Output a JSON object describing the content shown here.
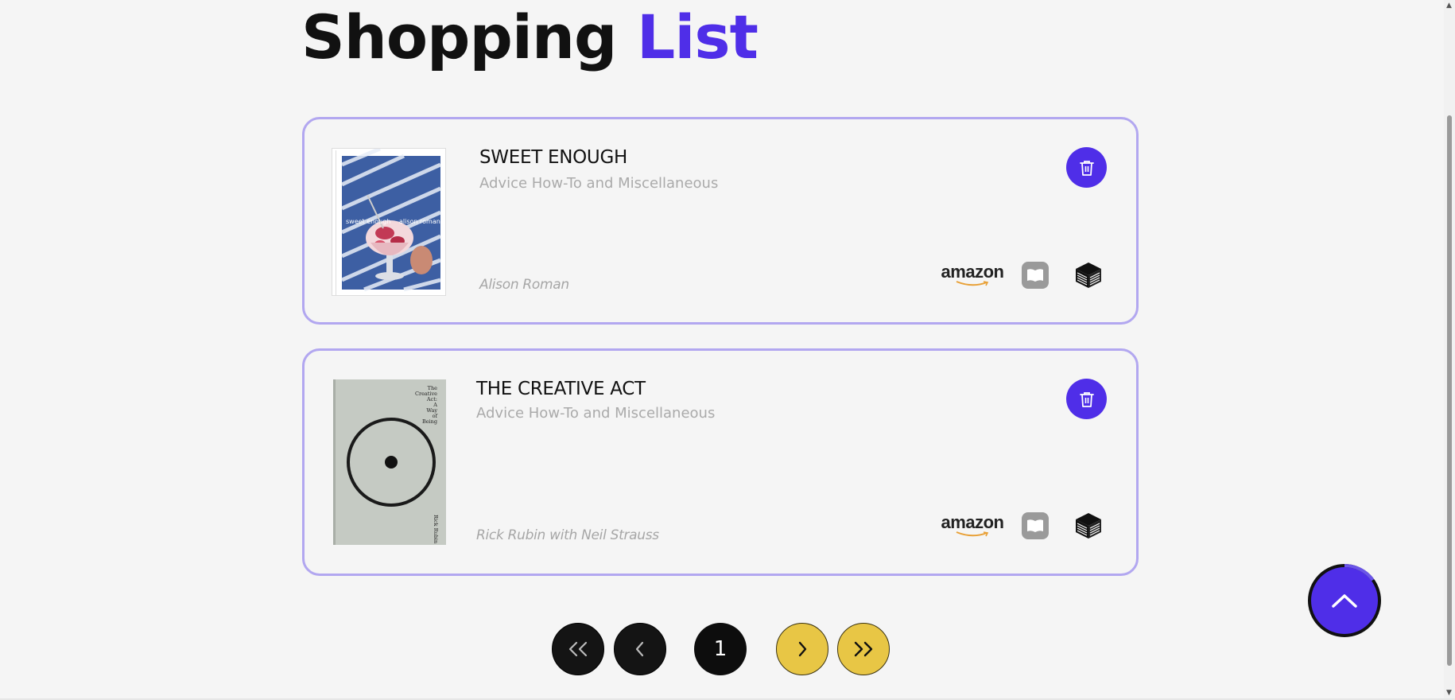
{
  "header": {
    "title_part1": "Shopping",
    "title_part2": "List"
  },
  "colors": {
    "accent": "#4f2ee8",
    "card_border": "#b2a7f0",
    "pager_yellow": "#e8c645",
    "pager_dark": "#141414"
  },
  "books": [
    {
      "title": "SWEET ENOUGH",
      "category": "Advice How-To and Miscellaneous",
      "author": "Alison Roman",
      "cover_text_left": "sweet enough",
      "cover_text_right": "alison roman",
      "stores": [
        "amazon",
        "apple-books",
        "bookshop"
      ]
    },
    {
      "title": "THE CREATIVE ACT",
      "category": "Advice How-To and Miscellaneous",
      "author": "Rick Rubin with Neil Strauss",
      "cover_title_lines": [
        "The",
        "Creative",
        "Act:",
        "A",
        "Way",
        "of",
        "Being"
      ],
      "cover_spine_author": "Rick Rubin",
      "stores": [
        "amazon",
        "apple-books",
        "bookshop"
      ]
    }
  ],
  "stores": {
    "amazon_label": "amazon"
  },
  "pagination": {
    "first_icon": "double-chevron-left-icon",
    "prev_icon": "chevron-left-icon",
    "current_page": "1",
    "next_icon": "chevron-right-icon",
    "last_icon": "double-chevron-right-icon"
  },
  "scroll_top": {
    "icon": "chevron-up-icon",
    "progress": 0.15
  },
  "icons": {
    "delete": "trash-icon",
    "apple_books": "book-open-icon",
    "bookshop": "bookshop-icon"
  }
}
